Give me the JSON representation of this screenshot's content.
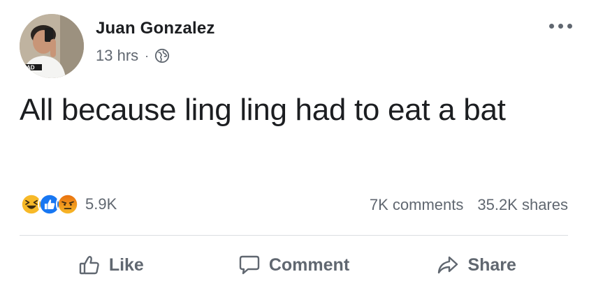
{
  "post": {
    "author": "Juan Gonzalez",
    "time": "13 hrs",
    "separator": "·",
    "privacy_icon": "globe-icon",
    "text": "All because ling ling had to eat a bat"
  },
  "stats": {
    "reaction_icons": [
      "haha-icon",
      "like-icon",
      "angry-icon"
    ],
    "reaction_count": "5.9K",
    "comments": "7K comments",
    "shares": "35.2K shares"
  },
  "actions": {
    "like": "Like",
    "comment": "Comment",
    "share": "Share"
  },
  "colors": {
    "like_blue": "#1877f2",
    "haha_yellow": "#f7b928",
    "angry_orange": "#e9710f",
    "secondary_text": "#606770",
    "divider": "#dadde1"
  }
}
